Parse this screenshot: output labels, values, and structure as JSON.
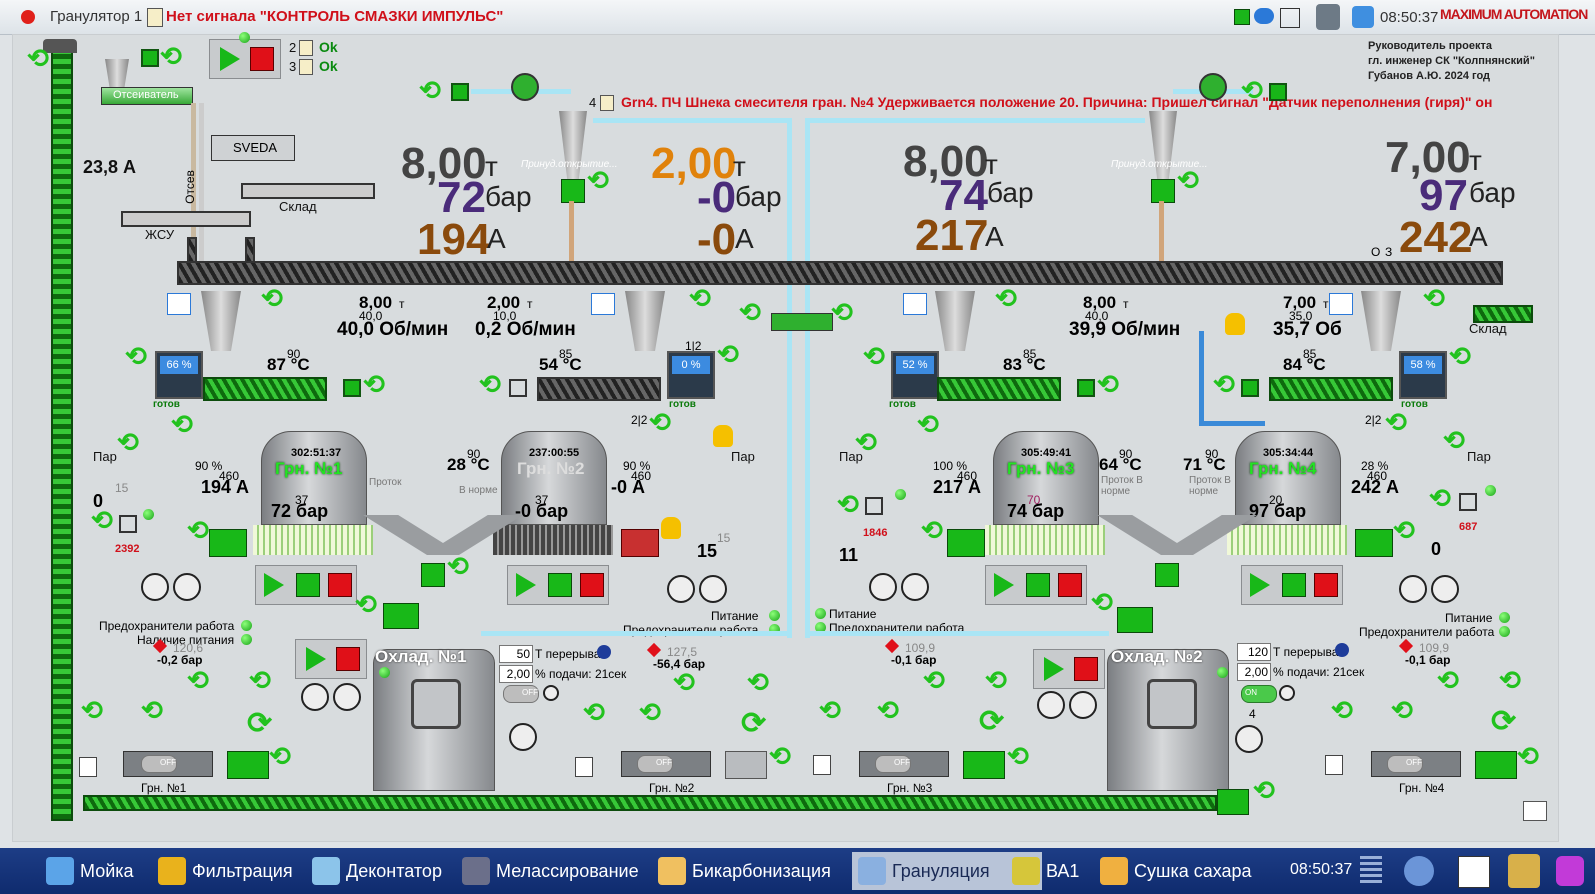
{
  "titlebar": {
    "app_name": "Гранулятор 1",
    "alarm_text": "Нет сигнала \"КОНТРОЛЬ СМАЗКИ ИМПУЛЬС\"",
    "clock": "08:50:37",
    "logo": "MAXIMUM AUTOMATION"
  },
  "project_info": {
    "line1": "Руководитель проекта",
    "line2": "гл. инженер СК \"Колпнянский\"",
    "line3": "Губанов А.Ю. 2024 год"
  },
  "status_msgs": {
    "n2": "2",
    "ok2": "Ok",
    "n3": "3",
    "ok3": "Ok",
    "n4": "4",
    "event": "Grn4. ПЧ Шнека смесителя гран. №4 Удерживается положение  20.   Причина: Пришел сигнал \"Датчик переполнения (гиря)\"  он"
  },
  "left_section": {
    "elevator_current": "23,8 А",
    "sifter_label": "Отсеиватель",
    "sveda_label": "SVEDA",
    "otsev_label": "Отсев",
    "sklad_label": "Склад",
    "zhsu_label": "ЖСУ"
  },
  "top_metrics": [
    {
      "t": "8,00",
      "t_unit": "т",
      "bar": "72",
      "bar_unit": "бар",
      "a": "194",
      "a_unit": "А",
      "a_small": "0"
    },
    {
      "t": "2,00",
      "t_unit": "т",
      "bar": "-0",
      "bar_unit": "бар",
      "a": "-0",
      "a_unit": "А"
    },
    {
      "t": "8,00",
      "t_unit": "т",
      "bar": "74",
      "bar_unit": "бар",
      "a": "217",
      "a_unit": "А",
      "a_small": "0"
    },
    {
      "t": "7,00",
      "t_unit": "т",
      "bar": "97",
      "bar_unit": "бар",
      "a": "242",
      "a_unit": "А",
      "a_small": "0"
    }
  ],
  "forced_open": "Принуд.открытие...",
  "screw_marks": {
    "o": "О",
    "z": "З"
  },
  "mixers": [
    {
      "t": "8,00",
      "t_unit": "т",
      "t_small": "40,0",
      "rpm": "40,0 Об/мин"
    },
    {
      "t": "2,00",
      "t_unit": "т",
      "t_small": "10,0",
      "rpm": "0,2 Об/мин"
    },
    {
      "t": "8,00",
      "t_unit": "т",
      "t_small": "40,0",
      "rpm": "39,9 Об/мин"
    },
    {
      "t": "7,00",
      "t_unit": "т",
      "t_small": "35,0",
      "rpm": "35,7 Об"
    }
  ],
  "sklad_right": "Склад",
  "granulators": [
    {
      "name": "Грн. №1",
      "time": "302:51:37",
      "temp": "87 °C",
      "temp_set": "90",
      "pct": "66 %",
      "ready": "готов",
      "pct_valve": "90 %",
      "current": "194 А",
      "current_set": "460",
      "pressure": "72 бар",
      "pressure_set": "37",
      "flow": "Проток",
      "counter": "2392",
      "zero": "0",
      "zero_small": "15",
      "steam": "Пар"
    },
    {
      "name": "Грн. №2",
      "time": "237:00:55",
      "temp": "54 °C",
      "temp_set": "85",
      "pct": "0 %",
      "ready": "готов",
      "pct_valve": "90 %",
      "current": "-0 А",
      "current_set": "460",
      "pressure": "-0 бар",
      "pressure_set": "37",
      "flow": "В норме",
      "counter": "15",
      "zero_small": "15",
      "steam": "Пар",
      "label_12": "1|2",
      "label_22": "2|2",
      "ext_temp": "28 °C",
      "ext_temp_set": "90"
    },
    {
      "name": "Грн. №3",
      "time": "305:49:41",
      "temp": "83 °C",
      "temp_set": "85",
      "pct": "52 %",
      "ready": "готов",
      "pct_valve": "100 %",
      "current": "217 А",
      "current_set": "460",
      "pressure": "74 бар",
      "pressure_set": "70",
      "flow": "Проток В норме",
      "counter": "1846",
      "zero": "11",
      "steam": "Пар",
      "ext_temp": "64 °C",
      "ext_temp_set": "90"
    },
    {
      "name": "Грн. №4",
      "time": "305:34:44",
      "temp": "84 °C",
      "temp_set": "85",
      "pct": "58 %",
      "ready": "готов",
      "pct_valve": "28 %",
      "current": "242 А",
      "current_set": "460",
      "pressure": "97 бар",
      "pressure_set": "20",
      "flow": "Проток В норме",
      "counter": "687",
      "zero": "0",
      "steam": "Пар",
      "label_22": "2|2",
      "ext_temp": "71 °C",
      "ext_temp_set": "90"
    }
  ],
  "coolers": [
    {
      "name": "Охлад. №1",
      "pause_val": "50",
      "pause_label": "Т перерыва",
      "feed_val": "2,00",
      "feed_label": "% подачи: 21сек",
      "toggle": "OFF"
    },
    {
      "name": "Охлад. №2",
      "pause_val": "120",
      "pause_label": "Т перерыва",
      "feed_val": "2,00",
      "feed_label": "% подачи: 21сек",
      "toggle": "ON",
      "num": "4"
    }
  ],
  "power_labels": {
    "left_fuses": "Предохранители работа",
    "left_power": "Наличие питания",
    "mid_power": "Питание",
    "mid_fuses": "Предохранители работа",
    "right_power": "Питание",
    "right_fuses": "Предохранители работа"
  },
  "bottom_units": [
    {
      "name": "Грн. №1",
      "pressure": "-0,2 бар",
      "set": "120,6",
      "toggle": "OFF"
    },
    {
      "name": "Грн. №2",
      "pressure": "-56,4 бар",
      "set": "127,5",
      "toggle": "OFF"
    },
    {
      "name": "Грн. №3",
      "pressure": "-0,1 бар",
      "set": "109,9",
      "toggle": "OFF"
    },
    {
      "name": "Грн. №4",
      "pressure": "-0,1 бар",
      "set": "109,9",
      "toggle": "OFF"
    }
  ],
  "taskbar": {
    "items": [
      "Мойка",
      "Фильтрация",
      "Деконтатор",
      "Мелассирование",
      "Бикарбонизация",
      "Грануляция",
      "ВА1",
      "Сушка сахара"
    ],
    "active": "Грануляция",
    "clock": "08:50:37"
  },
  "colors": {
    "accent_green": "#18b818",
    "alarm_red": "#d0101a",
    "pipe_blue": "#a9e5f5",
    "taskbar": "#0f2b6e"
  }
}
